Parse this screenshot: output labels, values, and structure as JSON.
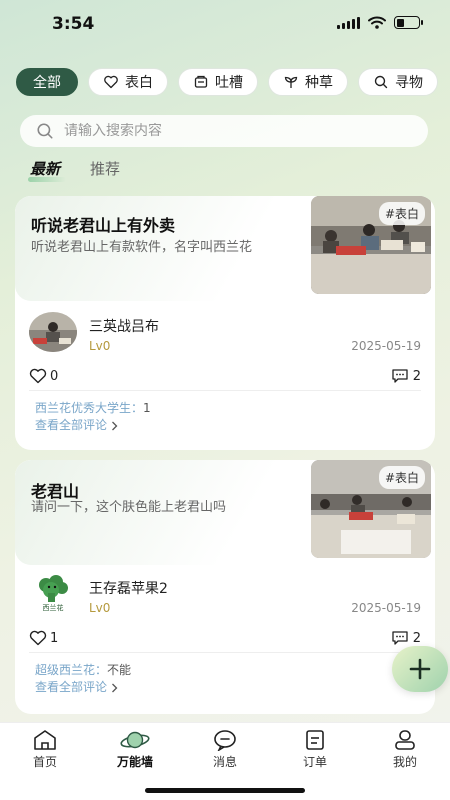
{
  "status": {
    "time": "3:54"
  },
  "categories": [
    {
      "label": "全部",
      "icon": "none",
      "active": true
    },
    {
      "label": "表白",
      "icon": "heart-icon"
    },
    {
      "label": "吐槽",
      "icon": "box-icon"
    },
    {
      "label": "种草",
      "icon": "sprout-icon"
    },
    {
      "label": "寻物",
      "icon": "search-icon"
    }
  ],
  "search": {
    "placeholder": "请输入搜索内容"
  },
  "feed_tabs": {
    "latest": "最新",
    "recommend": "推荐"
  },
  "posts": [
    {
      "title": "听说老君山上有外卖",
      "content": "听说老君山上有款软件，名字叫西兰花",
      "tag": "#表白",
      "author": "三英战吕布",
      "level": "Lv0",
      "date": "2025-05-19",
      "likes": "0",
      "comments_count": "2",
      "comment_author": "西兰花优秀大学生：",
      "comment_text": "1",
      "view_all": "查看全部评论"
    },
    {
      "title": "老君山",
      "content": "请问一下，这个肤色能上老君山吗",
      "tag": "#表白",
      "author": "王存磊苹果2",
      "level": "Lv0",
      "date": "2025-05-19",
      "likes": "1",
      "comments_count": "2",
      "comment_author": "超级西兰花：",
      "comment_text": "不能",
      "view_all": "查看全部评论",
      "avatar_text": "西兰花"
    }
  ],
  "nav": {
    "home": "首页",
    "wall": "万能墙",
    "messages": "消息",
    "orders": "订单",
    "mine": "我的"
  },
  "colors": {
    "accent": "#2f5a45",
    "link": "#7aa6c9",
    "level": "#b59a3e"
  }
}
